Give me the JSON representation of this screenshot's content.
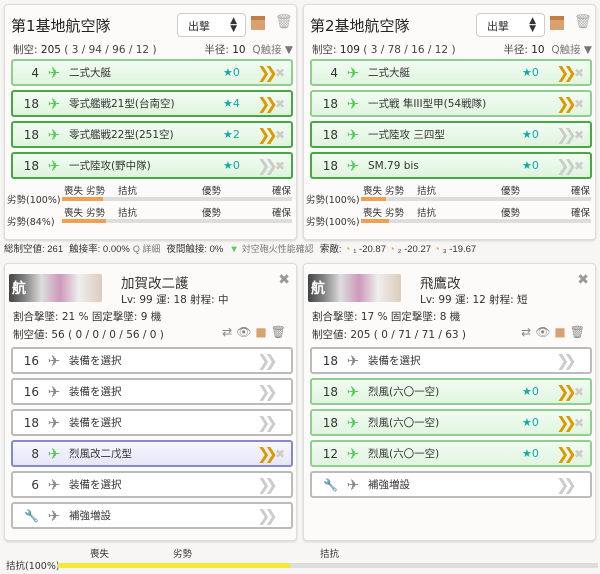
{
  "bases": [
    {
      "title": "第1基地航空隊",
      "mode": "出撃",
      "air_label": "制空:",
      "air": "205",
      "air_detail": "( 3 / 94 / 96 / 12 )",
      "radius_label": "半径:",
      "radius": "10",
      "contact": "Q触接 ▼",
      "rows": [
        {
          "count": "4",
          "name": "二式大艇",
          "star": "★0",
          "style": "g1",
          "chev": "on",
          "plane": "gray-green"
        },
        {
          "count": "18",
          "name": "零式艦戦21型(台南空)",
          "star": "★4",
          "style": "g2",
          "chev": "on"
        },
        {
          "count": "18",
          "name": "零式艦戦22型(251空)",
          "star": "★2",
          "style": "g2",
          "chev": "on"
        },
        {
          "count": "18",
          "name": "一式陸攻(野中隊)",
          "star": "★0",
          "style": "g2",
          "chev": "off"
        }
      ],
      "gauges": [
        {
          "label": "劣勢(100%)",
          "fill": 0.18
        },
        {
          "label": "劣勢(84%)",
          "fill": 0.19
        }
      ]
    },
    {
      "title": "第2基地航空隊",
      "mode": "出撃",
      "air_label": "制空:",
      "air": "109",
      "air_detail": "( 3 / 78 / 16 / 12 )",
      "radius_label": "半径:",
      "radius": "10",
      "contact": "Q触接 ▼",
      "rows": [
        {
          "count": "4",
          "name": "二式大艇",
          "star": "★0",
          "style": "g1",
          "chev": "on"
        },
        {
          "count": "18",
          "name": "一式戦 隼III型甲(54戦隊)",
          "star": "",
          "style": "g1",
          "chev": "on"
        },
        {
          "count": "18",
          "name": "一式陸攻 三四型",
          "star": "★0",
          "style": "g2",
          "chev": "off"
        },
        {
          "count": "18",
          "name": "SM.79 bis",
          "star": "★0",
          "style": "g2",
          "chev": "off"
        }
      ],
      "gauges": [
        {
          "label": "劣勢(100%)",
          "fill": 0.11
        },
        {
          "label": "劣勢(100%)",
          "fill": 0.12
        }
      ]
    }
  ],
  "gauge_cols": [
    "喪失",
    "劣勢",
    "拮抗",
    "優勢",
    "確保"
  ],
  "summary": {
    "total_air": "総制空値: 261",
    "contact_rate": "触接率: 0.00%",
    "detail": "Q 詳細",
    "night_contact": "夜間触接: 0%",
    "aa_check": "対空砲火性能確認",
    "search": "索敵:",
    "s1": "₁ -20.87",
    "s2": "₂ -20.27",
    "s3": "₃ -19.67"
  },
  "ships": [
    {
      "name": "加賀改二護",
      "badge": "航",
      "lv": "Lv: 99  運: 18  射程: 中",
      "rate": "割合撃墜: 21 %  固定撃墜: 9 機",
      "air": "制空値: 56 ( 0 / 0 / 0 / 56 / 0 )",
      "rows": [
        {
          "count": "16",
          "name": "装備を選択",
          "star": "",
          "style": "",
          "chev": "off",
          "empty": true
        },
        {
          "count": "16",
          "name": "装備を選択",
          "star": "",
          "style": "",
          "chev": "off",
          "empty": true
        },
        {
          "count": "18",
          "name": "装備を選択",
          "star": "",
          "style": "",
          "chev": "off",
          "empty": true
        },
        {
          "count": "8",
          "name": "烈風改二戊型",
          "star": "",
          "style": "p",
          "chev": "on"
        },
        {
          "count": "6",
          "name": "装備を選択",
          "star": "",
          "style": "",
          "chev": "off",
          "empty": true
        },
        {
          "count": "🔧",
          "name": "補強増設",
          "star": "",
          "style": "",
          "chev": "off",
          "empty": true
        }
      ]
    },
    {
      "name": "飛鷹改",
      "badge": "航",
      "lv": "Lv: 99  運: 12  射程: 短",
      "rate": "割合撃墜: 17 %  固定撃墜: 8 機",
      "air": "制空値: 205 ( 0 / 71 / 71 / 63 )",
      "rows": [
        {
          "count": "18",
          "name": "装備を選択",
          "star": "",
          "style": "",
          "chev": "off",
          "empty": true
        },
        {
          "count": "18",
          "name": "烈風(六〇一空)",
          "star": "★0",
          "style": "g1",
          "chev": "on"
        },
        {
          "count": "18",
          "name": "烈風(六〇一空)",
          "star": "★0",
          "style": "g1",
          "chev": "on"
        },
        {
          "count": "12",
          "name": "烈風(六〇一空)",
          "star": "★0",
          "style": "g1",
          "chev": "on"
        },
        {
          "count": "🔧",
          "name": "補強増設",
          "star": "",
          "style": "",
          "chev": "off",
          "empty": true
        }
      ]
    }
  ],
  "bottom": {
    "label": "拮抗(100%)",
    "cols": [
      "喪失",
      "劣勢",
      "拮抗"
    ],
    "fill": 0.43
  }
}
